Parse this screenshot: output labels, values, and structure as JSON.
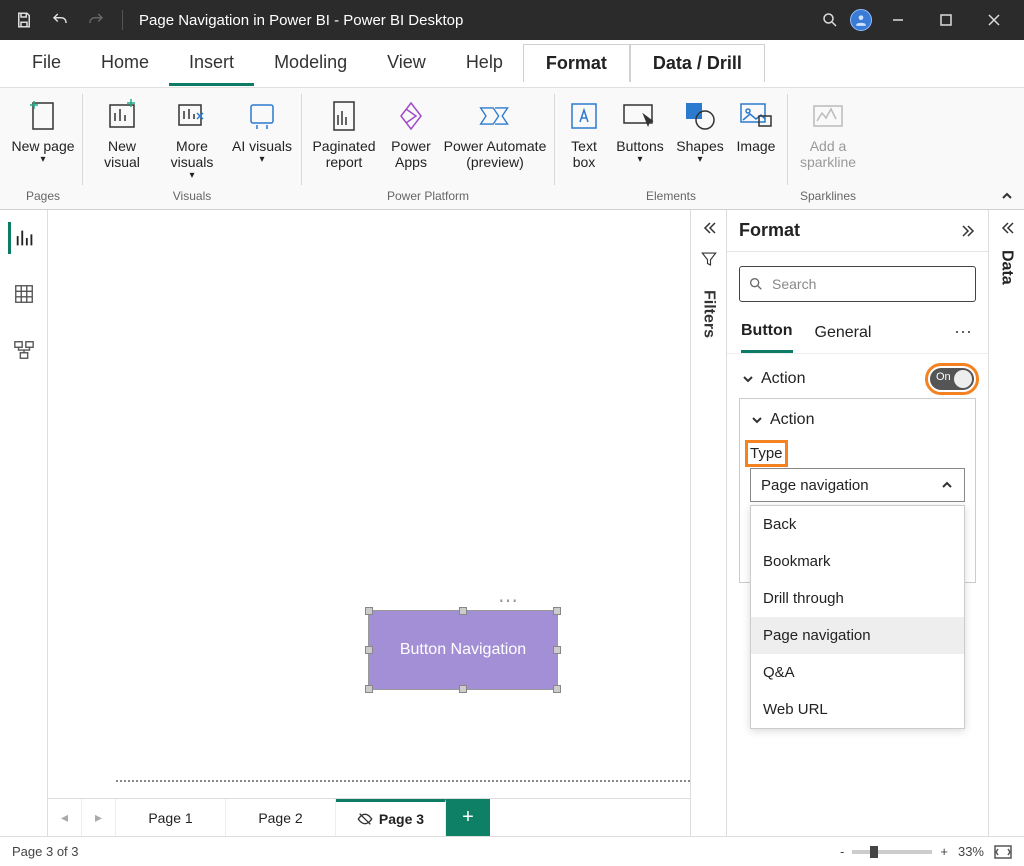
{
  "titlebar": {
    "title": "Page Navigation in Power BI - Power BI Desktop"
  },
  "tabs": {
    "file": "File",
    "home": "Home",
    "insert": "Insert",
    "modeling": "Modeling",
    "view": "View",
    "help": "Help",
    "format": "Format",
    "datadrill": "Data / Drill"
  },
  "ribbon": {
    "pages": {
      "new_page": "New page",
      "group": "Pages"
    },
    "visuals": {
      "new_visual": "New visual",
      "more_visuals": "More visuals",
      "ai_visuals": "AI visuals",
      "group": "Visuals"
    },
    "platform": {
      "paginated": "Paginated report",
      "powerapps": "Power Apps",
      "automate_l1": "Power Automate",
      "automate_l2": "(preview)",
      "group": "Power Platform"
    },
    "elements": {
      "textbox": "Text box",
      "buttons": "Buttons",
      "shapes": "Shapes",
      "image": "Image",
      "group": "Elements"
    },
    "sparklines": {
      "add": "Add a sparkline",
      "group": "Sparklines"
    }
  },
  "canvas": {
    "button_text": "Button Navigation"
  },
  "pages": {
    "p1": "Page 1",
    "p2": "Page 2",
    "p3": "Page 3"
  },
  "filters": {
    "label": "Filters"
  },
  "format_pane": {
    "title": "Format",
    "search_placeholder": "Search",
    "tab_button": "Button",
    "tab_general": "General",
    "section_action": "Action",
    "toggle_on": "On",
    "inner_action": "Action",
    "type_label": "Type",
    "type_value": "Page navigation",
    "options": [
      "Back",
      "Bookmark",
      "Drill through",
      "Page navigation",
      "Q&A",
      "Web URL"
    ]
  },
  "data_pane": {
    "label": "Data"
  },
  "status": {
    "page_of": "Page 3 of 3",
    "zoom": "33%"
  }
}
